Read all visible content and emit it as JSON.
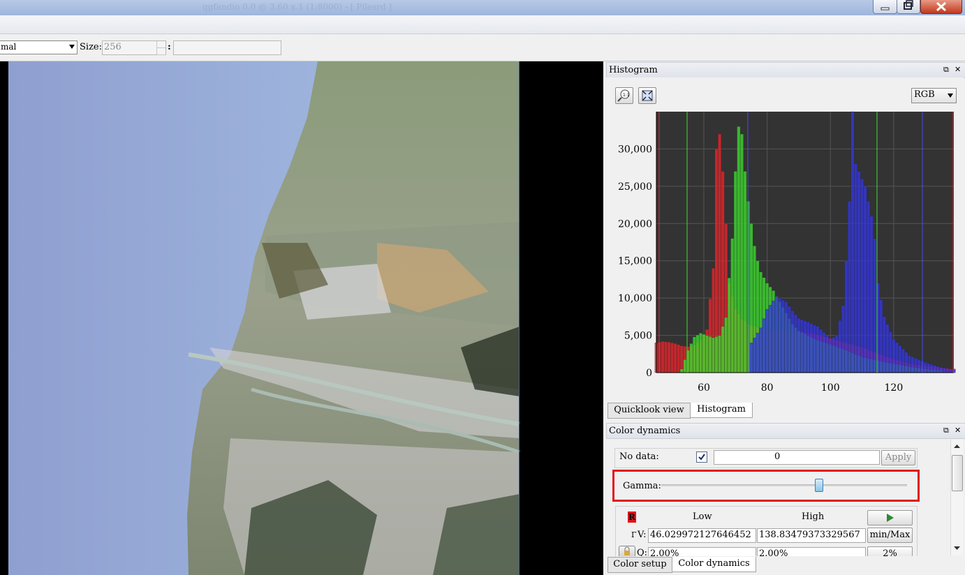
{
  "window": {
    "title": "qgfandio 0.0 @ 3.60 x.1 (1:8000) - [ Pilesrd ]"
  },
  "toolbar": {
    "mode_value": "mal",
    "size_label": "Size:",
    "size_value": "256",
    "colon": ":"
  },
  "histogram_panel": {
    "title": "Histogram",
    "channel_select": "RGB",
    "tools": [
      "zoom-1to1-icon",
      "zoom-fit-icon"
    ],
    "tabs": [
      "Quicklook view",
      "Histogram"
    ],
    "active_tab": "Histogram"
  },
  "chart_data": {
    "type": "bar",
    "title": "",
    "xlabel": "",
    "ylabel": "",
    "xlim": [
      45,
      139
    ],
    "ylim": [
      0,
      35000
    ],
    "x_ticks": [
      "60",
      "80",
      "100",
      "120"
    ],
    "y_ticks": [
      "0",
      "5,000",
      "10,000",
      "15,000",
      "20,000",
      "25,000",
      "30,000"
    ],
    "grid": true,
    "background": "#333333",
    "series": [
      {
        "color": "#e8262c",
        "x": [
          45,
          47,
          49,
          51,
          53,
          55,
          57,
          59,
          61,
          63,
          64,
          65,
          66,
          67,
          68,
          70,
          72,
          74,
          76,
          78,
          80,
          85,
          90,
          95,
          100,
          105,
          110,
          115,
          120,
          125,
          130,
          135,
          139
        ],
        "y": [
          4000,
          4200,
          4100,
          3900,
          3600,
          3500,
          3700,
          4400,
          5800,
          14000,
          30000,
          32000,
          27000,
          20000,
          12000,
          8500,
          7200,
          6500,
          6200,
          5900,
          5800,
          5600,
          5500,
          5200,
          4600,
          4000,
          3400,
          2600,
          1800,
          1200,
          900,
          700,
          500
        ]
      },
      {
        "color": "#3cdc2e",
        "x": [
          53,
          55,
          57,
          59,
          61,
          63,
          65,
          67,
          69,
          70,
          71,
          72,
          73,
          74,
          75,
          76,
          77,
          78,
          80,
          82,
          84,
          86,
          88,
          90,
          95,
          100,
          105,
          110,
          115,
          120,
          125,
          130,
          135
        ],
        "y": [
          500,
          3000,
          4800,
          5300,
          5000,
          4700,
          5000,
          7400,
          18000,
          27000,
          33000,
          32000,
          27000,
          23000,
          20000,
          17000,
          15000,
          13500,
          12000,
          11000,
          9500,
          8000,
          6500,
          5600,
          4500,
          3800,
          3000,
          2100,
          1600,
          1200,
          800,
          500,
          300
        ]
      },
      {
        "color": "#3436e0",
        "x": [
          75,
          78,
          80,
          83,
          86,
          88,
          90,
          93,
          96,
          98,
          100,
          102,
          104,
          105,
          106,
          107,
          108,
          109,
          110,
          111,
          112,
          113,
          114,
          115,
          117,
          120,
          125,
          130,
          135,
          139
        ],
        "y": [
          4000,
          6000,
          8500,
          10200,
          9500,
          8300,
          7300,
          6800,
          6200,
          5400,
          4500,
          5000,
          9000,
          15000,
          23000,
          35000,
          28000,
          27000,
          26000,
          25000,
          23000,
          21000,
          18000,
          12000,
          7500,
          4500,
          2300,
          1400,
          700,
          400
        ]
      }
    ]
  },
  "color_dynamics": {
    "title": "Color dynamics",
    "no_data_label": "No data:",
    "no_data_checked": true,
    "no_data_value": "0",
    "apply_label": "Apply",
    "gamma_label": "Gamma:",
    "gamma_position": 0.64,
    "channel_badge": "R",
    "low_label": "Low",
    "high_label": "High",
    "v_label": "V:",
    "v_low": "46.029972127646452",
    "v_high": "138.83479373329567",
    "minmax_label": "min/Max",
    "q_label": "Q:",
    "q_low": "2.00%",
    "q_high": "2.00%",
    "pct_label": "2%",
    "tabs": [
      "Color setup",
      "Color dynamics"
    ],
    "active_tab": "Color dynamics"
  }
}
